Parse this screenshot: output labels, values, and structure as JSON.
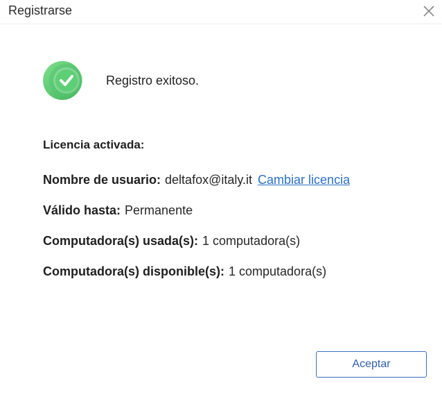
{
  "dialog": {
    "title": "Registrarse",
    "close_icon": "close-icon"
  },
  "status": {
    "icon": "check-circle-icon",
    "icon_color": "#4cc36a",
    "message": "Registro exitoso."
  },
  "license": {
    "section_title": "Licencia activada:",
    "username_label": "Nombre de usuario:",
    "username_value": "deltafox@italy.it",
    "change_link": "Cambiar licencia",
    "valid_label": "Válido hasta:",
    "valid_value": "Permanente",
    "used_label": "Computadora(s) usada(s):",
    "used_value": "1 computadora(s)",
    "available_label": "Computadora(s) disponible(s):",
    "available_value": "1 computadora(s)"
  },
  "actions": {
    "accept_label": "Aceptar",
    "accent_color": "#3c6fbf"
  }
}
